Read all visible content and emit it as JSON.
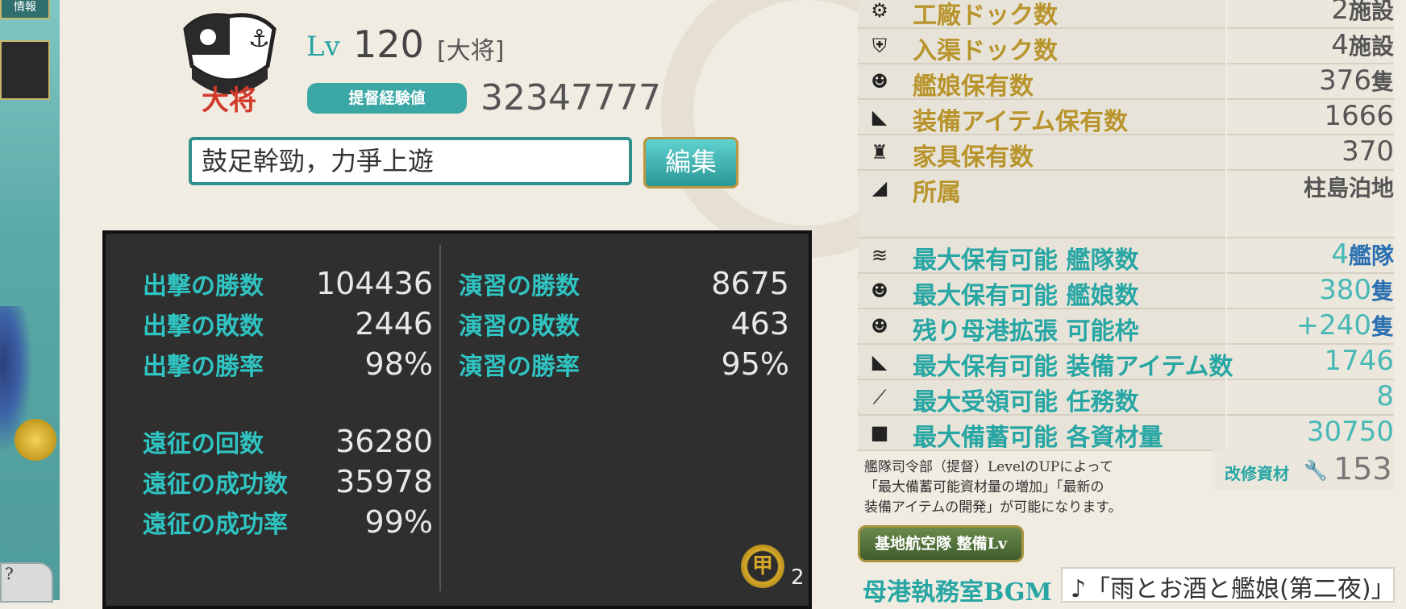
{
  "left_strip": {
    "tab_label": "情報",
    "corner_label": "?"
  },
  "profile": {
    "emblem_text": "大将",
    "lv_prefix": "Lv",
    "level": "120",
    "rank": "[大将]",
    "exp_label": "提督経験値",
    "exp_value": "32347777",
    "comment": "鼓足幹勁，力爭上遊",
    "edit_label": "編集"
  },
  "stats": {
    "sortie_wins_label": "出撃の勝数",
    "sortie_wins": "104436",
    "sortie_losses_label": "出撃の敗数",
    "sortie_losses": "2446",
    "sortie_rate_label": "出撃の勝率",
    "sortie_rate": "98%",
    "exercise_wins_label": "演習の勝数",
    "exercise_wins": "8675",
    "exercise_losses_label": "演習の敗数",
    "exercise_losses": "463",
    "exercise_rate_label": "演習の勝率",
    "exercise_rate": "95%",
    "expedition_count_label": "遠征の回数",
    "expedition_count": "36280",
    "expedition_success_label": "遠征の成功数",
    "expedition_success": "35978",
    "expedition_rate_label": "遠征の成功率",
    "expedition_rate": "99%",
    "kou_badge": "甲",
    "kou_count": "2"
  },
  "right_panel": {
    "rows": [
      {
        "icon": "gear-icon",
        "label": "工廠ドック数",
        "value": "2",
        "unit": "施設"
      },
      {
        "icon": "repair-shield-icon",
        "label": "入渠ドック数",
        "value": "4",
        "unit": "施設"
      },
      {
        "icon": "ship-girl-icon",
        "label": "艦娘保有数",
        "value": "376",
        "unit": "隻"
      },
      {
        "icon": "equipment-icon",
        "label": "装備アイテム保有数",
        "value": "1666",
        "unit": ""
      },
      {
        "icon": "furniture-icon",
        "label": "家具保有数",
        "value": "370",
        "unit": ""
      },
      {
        "icon": "base-icon",
        "label": "所属",
        "value": "",
        "unit": "柱島泊地"
      }
    ],
    "max_rows": [
      {
        "icon": "fleet-icon",
        "label": "最大保有可能 艦隊数",
        "value": "4",
        "unit": "艦隊"
      },
      {
        "icon": "ship-girl-icon",
        "label": "最大保有可能 艦娘数",
        "value": "380",
        "unit": "隻"
      },
      {
        "icon": "port-expand-icon",
        "label": "残り母港拡張 可能枠",
        "value": "+240",
        "unit": "隻"
      },
      {
        "icon": "equipment-icon",
        "label": "最大保有可能 装備アイテム数",
        "value": "1746",
        "unit": ""
      },
      {
        "icon": "feather-icon",
        "label": "最大受領可能 任務数",
        "value": "8",
        "unit": ""
      },
      {
        "icon": "resource-icon",
        "label": "最大備蓄可能 各資材量",
        "value": "30750",
        "unit": ""
      }
    ],
    "note_line1": "艦隊司令部（提督）LevelのUPによって",
    "note_line2": "「最大備蓄可能資材量の増加」「最新の",
    "note_line3": "装備アイテムの開発」が可能になります。",
    "kaisyu_label": "改修資材",
    "kaisyu_value": "153",
    "base_air_label": "基地航空隊 整備Lv",
    "bgm_label": "母港執務室BGM",
    "bgm_value": "♪「雨とお酒と艦娘(第二夜)」"
  },
  "colors": {
    "teal": "#27a6a4",
    "gold": "#b8942c",
    "board": "#2f2f2f"
  }
}
